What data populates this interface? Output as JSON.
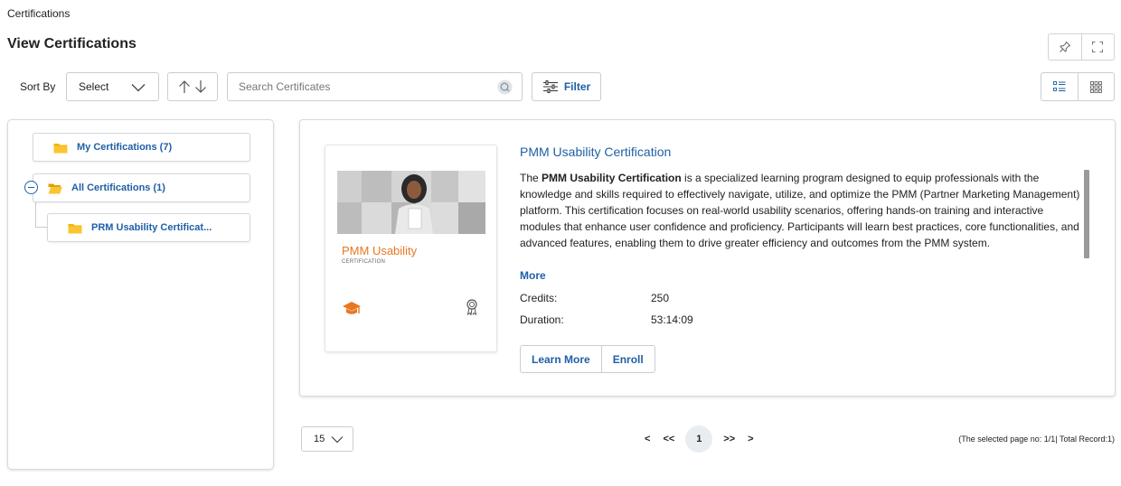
{
  "breadcrumb": "Certifications",
  "page_title": "View Certifications",
  "toolbar": {
    "sort_label": "Sort By",
    "sort_value": "Select",
    "search_placeholder": "Search Certificates",
    "filter_label": "Filter",
    "icons": [
      "pin-icon",
      "fullscreen-icon",
      "list-view-icon",
      "grid-view-icon",
      "sort-up-icon",
      "sort-down-icon",
      "search-icon",
      "filter-sliders-icon",
      "chevron-down-icon"
    ]
  },
  "tree": {
    "my_certifications": "My Certifications (7)",
    "all_certifications": "All Certifications (1)",
    "prm_node": "PRM Usability Certificat..."
  },
  "card": {
    "thumb_title": "PMM Usability",
    "thumb_subtitle": "CERTIFICATION",
    "title": "PMM Usability Certification",
    "desc_bold": "PMM Usability Certification",
    "desc_pre": "The ",
    "desc_post": " is a specialized learning program designed to equip professionals with the knowledge and skills required to effectively navigate, utilize, and optimize the PMM (Partner Marketing Management) platform. This certification focuses on real-world usability scenarios, offering hands-on training and interactive modules that enhance user confidence and proficiency. Participants will learn best practices, core functionalities, and advanced features, enabling them to drive greater efficiency and outcomes from the PMM system.",
    "more_label": "More",
    "credits_label": "Credits:",
    "credits_value": "250",
    "duration_label": "Duration:",
    "duration_value": "53:14:09",
    "learn_more_label": "Learn More",
    "enroll_label": "Enroll"
  },
  "pagination": {
    "page_size": "15",
    "prev": "<",
    "first": "<<",
    "current": "1",
    "last": ">>",
    "next": ">",
    "info": "(The selected page no: 1/1| Total Record:1)"
  },
  "colors": {
    "accent": "#1f5fa6",
    "orange": "#e87722",
    "folder": "#f4b400"
  }
}
